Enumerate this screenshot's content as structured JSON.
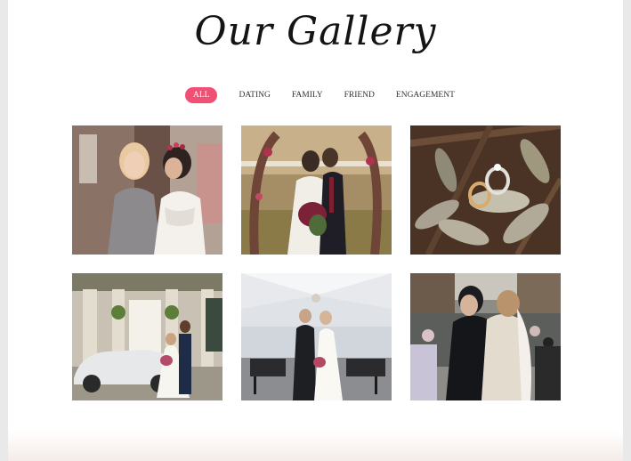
{
  "gallery": {
    "title": "Our Gallery",
    "filters": [
      {
        "label": "ALL",
        "active": true
      },
      {
        "label": "DATING",
        "active": false
      },
      {
        "label": "FAMILY",
        "active": false
      },
      {
        "label": "FRIEND",
        "active": false
      },
      {
        "label": "ENGAGEMENT",
        "active": false
      }
    ],
    "accent_color": "#f14f74",
    "photos": [
      {
        "subject": "bride-with-bridesmaid"
      },
      {
        "subject": "couple-kiss-floral-arch"
      },
      {
        "subject": "wedding-rings-on-succulent"
      },
      {
        "subject": "couple-vintage-car"
      },
      {
        "subject": "couple-tent-reception"
      },
      {
        "subject": "couple-embrace-guests"
      }
    ]
  }
}
